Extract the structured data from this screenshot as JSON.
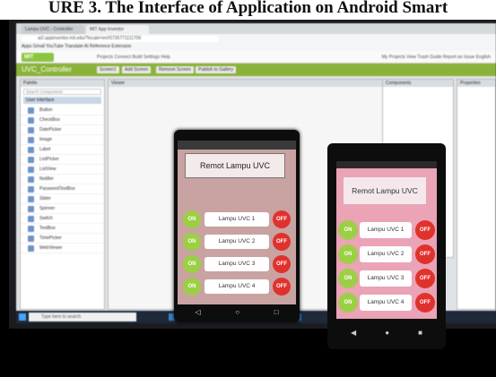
{
  "caption": "URE 3. The Interface of Application on Android Smart",
  "browser": {
    "tabs": [
      "Lampu UVC - Controller",
      "MIT App Inventor"
    ],
    "url": "ai2.appinventor.mit.edu/?locale=en#5726771111706",
    "bookmarks": "Apps   Gmail   YouTube   Translate   AI Reference   Extension"
  },
  "app_inventor": {
    "menu": "Projects   Connect   Build   Settings   Help",
    "menu_right": "My Projects   View Trash   Guide   Report an Issue   English",
    "project_name": "UVC_Controller",
    "buttons": [
      "Screen1",
      "Add Screen",
      "Remove Screen",
      "Publish to Gallery"
    ],
    "palette_title": "Palette",
    "palette_search": "Search Components",
    "palette_group": "User Interface",
    "palette_items": [
      "Button",
      "CheckBox",
      "DatePicker",
      "Image",
      "Label",
      "ListPicker",
      "ListView",
      "Notifier",
      "PasswordTextBox",
      "Slider",
      "Spinner",
      "Switch",
      "TextBox",
      "TimePicker",
      "WebViewer"
    ],
    "viewer_title": "Viewer",
    "components_title": "Components",
    "properties_title": "Properties"
  },
  "taskbar": {
    "search_placeholder": "Type here to search"
  },
  "phone_emulator": {
    "title": "Remot Lampu UVC",
    "on_label": "ON",
    "off_label": "OFF",
    "lamps": [
      "Lampu UVC 1",
      "Lampu UVC 2",
      "Lampu UVC 3",
      "Lampu UVC 4"
    ]
  },
  "phone_device": {
    "title": "Remot Lampu UVC",
    "on_label": "ON",
    "off_label": "OFF",
    "lamps": [
      "Lampu UVC 1",
      "Lampu UVC 2",
      "Lampu UVC 3",
      "Lampu UVC 4"
    ]
  },
  "colors": {
    "on_button": "#9ccf45",
    "off_button": "#e0322d",
    "appinventor_green": "#8bb33a",
    "device_screen": "#eba3b6"
  }
}
